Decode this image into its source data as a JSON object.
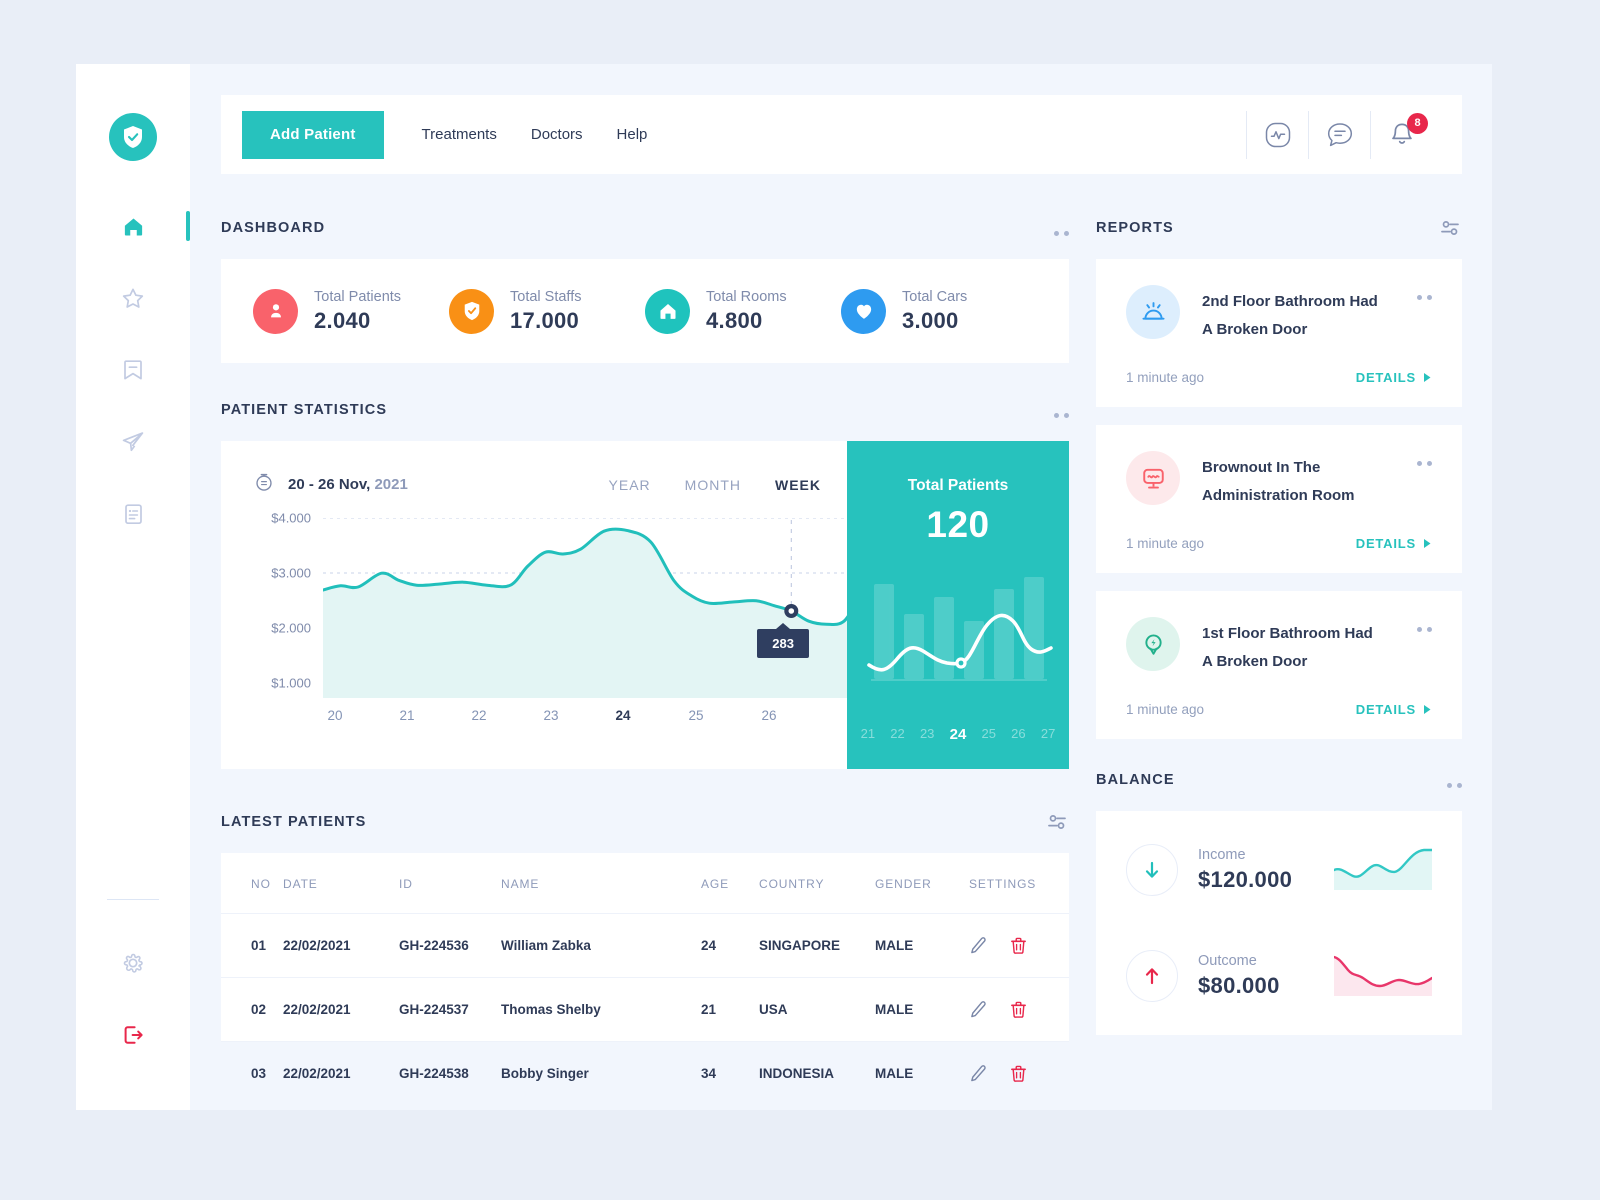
{
  "brand": {
    "accent": "#27c2bd",
    "navy": "#2f3b57",
    "red": "#e8274b"
  },
  "sidebar": {
    "logo_icon": "shield-check-icon",
    "items": [
      {
        "icon": "home-icon",
        "name": "home",
        "active": true
      },
      {
        "icon": "star-icon",
        "name": "favorites",
        "active": false
      },
      {
        "icon": "bookmark-icon",
        "name": "bookmarks",
        "active": false
      },
      {
        "icon": "send-icon",
        "name": "messages",
        "active": false
      },
      {
        "icon": "document-icon",
        "name": "documents",
        "active": false
      }
    ],
    "bottom": [
      {
        "icon": "gear-icon",
        "name": "settings"
      },
      {
        "icon": "logout-icon",
        "name": "logout"
      }
    ]
  },
  "topbar": {
    "add_patient_label": "Add Patient",
    "nav": [
      {
        "label": "Treatments"
      },
      {
        "label": "Doctors"
      },
      {
        "label": "Help"
      }
    ],
    "icons": [
      {
        "name": "activity-icon"
      },
      {
        "name": "chat-icon"
      },
      {
        "name": "bell-icon"
      }
    ],
    "notification_count": "8"
  },
  "dashboard": {
    "title": "DASHBOARD",
    "stats": [
      {
        "label": "Total Patients",
        "value": "2.040",
        "icon": "user-icon",
        "color": "#f9626b"
      },
      {
        "label": "Total Staffs",
        "value": "17.000",
        "icon": "shield-check-icon",
        "color": "#f99015"
      },
      {
        "label": "Total Rooms",
        "value": "4.800",
        "icon": "home-icon",
        "color": "#1fc3bd"
      },
      {
        "label": "Total Cars",
        "value": "3.000",
        "icon": "heart-icon",
        "color": "#2e9bf0"
      }
    ]
  },
  "patient_statistics": {
    "title": "PATIENT STATISTICS",
    "calendar_icon": "calendar-icon",
    "date_range": "20 - 26 Nov,",
    "date_year": "2021",
    "ranges": [
      {
        "label": "YEAR",
        "active": false
      },
      {
        "label": "MONTH",
        "active": false
      },
      {
        "label": "WEEK",
        "active": true
      }
    ],
    "tooltip_value": "283",
    "side_panel": {
      "title": "Total Patients",
      "value": "120",
      "xlabels": [
        "21",
        "22",
        "23",
        "24",
        "25",
        "26",
        "27"
      ],
      "active_index": 3
    }
  },
  "chart_data": {
    "type": "area",
    "title": "Patient Statistics",
    "xlabel": "",
    "ylabel": "",
    "grid": true,
    "legend": "none",
    "ytick_labels": [
      "$4.000",
      "$3.000",
      "$2.000",
      "$1.000"
    ],
    "ylim": [
      1000,
      4000
    ],
    "xtick_labels": [
      "20",
      "21",
      "22",
      "23",
      "24",
      "25",
      "26"
    ],
    "xlim": [
      20,
      26
    ],
    "highlight_x": "24",
    "highlight_value": 283,
    "series": [
      {
        "name": "Patients",
        "color": "#21bfbb",
        "fill": "#e3f5f4",
        "x": [
          20.0,
          20.15,
          20.3,
          20.5,
          20.65,
          20.8,
          21.0,
          21.2,
          21.4,
          21.6,
          21.75,
          21.9,
          22.05,
          22.2,
          22.4,
          22.6,
          22.8,
          23.0,
          23.15,
          23.3,
          23.5,
          23.7,
          23.85,
          24.0,
          24.15,
          24.3,
          24.45,
          24.6,
          24.8,
          25.0,
          25.2,
          25.4,
          25.6,
          25.8,
          26.0,
          26.15
        ],
        "y": [
          2800,
          2870,
          2850,
          3080,
          2960,
          2880,
          2900,
          2930,
          2880,
          2880,
          3200,
          3430,
          3400,
          3480,
          3780,
          3790,
          3600,
          2950,
          2700,
          2580,
          2600,
          2620,
          2540,
          2450,
          2280,
          2230,
          2280,
          2700,
          3000,
          3030,
          3180,
          3150,
          3270,
          3290,
          3330,
          3220
        ]
      }
    ]
  },
  "latest_patients": {
    "title": "LATEST PATIENTS",
    "filter_icon": "sliders-icon",
    "columns": [
      "NO",
      "DATE",
      "ID",
      "NAME",
      "AGE",
      "COUNTRY",
      "GENDER",
      "SETTINGS"
    ],
    "rows": [
      {
        "no": "01",
        "date": "22/02/2021",
        "id": "GH-224536",
        "name": "William Zabka",
        "age": "24",
        "country": "SINGAPORE",
        "gender": "MALE"
      },
      {
        "no": "02",
        "date": "22/02/2021",
        "id": "GH-224537",
        "name": "Thomas Shelby",
        "age": "21",
        "country": "USA",
        "gender": "MALE"
      },
      {
        "no": "03",
        "date": "22/02/2021",
        "id": "GH-224538",
        "name": "Bobby Singer",
        "age": "34",
        "country": "INDONESIA",
        "gender": "MALE"
      }
    ],
    "row_actions": [
      {
        "icon": "edit-pencil-icon"
      },
      {
        "icon": "trash-icon"
      }
    ]
  },
  "reports": {
    "title": "REPORTS",
    "filter_icon": "sliders-icon",
    "items": [
      {
        "title_line1": "2nd Floor Bathroom Had",
        "title_line2": "A Broken Door",
        "time": "1 minute ago",
        "details_label": "DETAILS",
        "icon": "alarm-icon",
        "icon_color": "#2e9bf0",
        "icon_bg": "#ddeefd"
      },
      {
        "title_line1": "Brownout In The",
        "title_line2": "Administration Room",
        "time": "1 minute ago",
        "details_label": "DETAILS",
        "icon": "monitor-pulse-icon",
        "icon_color": "#f9626b",
        "icon_bg": "#fde9eb"
      },
      {
        "title_line1": "1st Floor Bathroom Had",
        "title_line2": "A Broken Door",
        "time": "1 minute ago",
        "details_label": "DETAILS",
        "icon": "power-pin-icon",
        "icon_color": "#21b08b",
        "icon_bg": "#dff4ed"
      }
    ]
  },
  "balance": {
    "title": "BALANCE",
    "rows": [
      {
        "label": "Income",
        "value": "$120.000",
        "icon": "arrow-down-icon",
        "icon_color": "#21bfbb",
        "spark_color": "#32c8c5",
        "spark_fill": "#e2f6f5"
      },
      {
        "label": "Outcome",
        "value": "$80.000",
        "icon": "arrow-up-icon",
        "icon_color": "#e8274b",
        "spark_color": "#e8366a",
        "spark_fill": "#fce7ee"
      }
    ]
  }
}
